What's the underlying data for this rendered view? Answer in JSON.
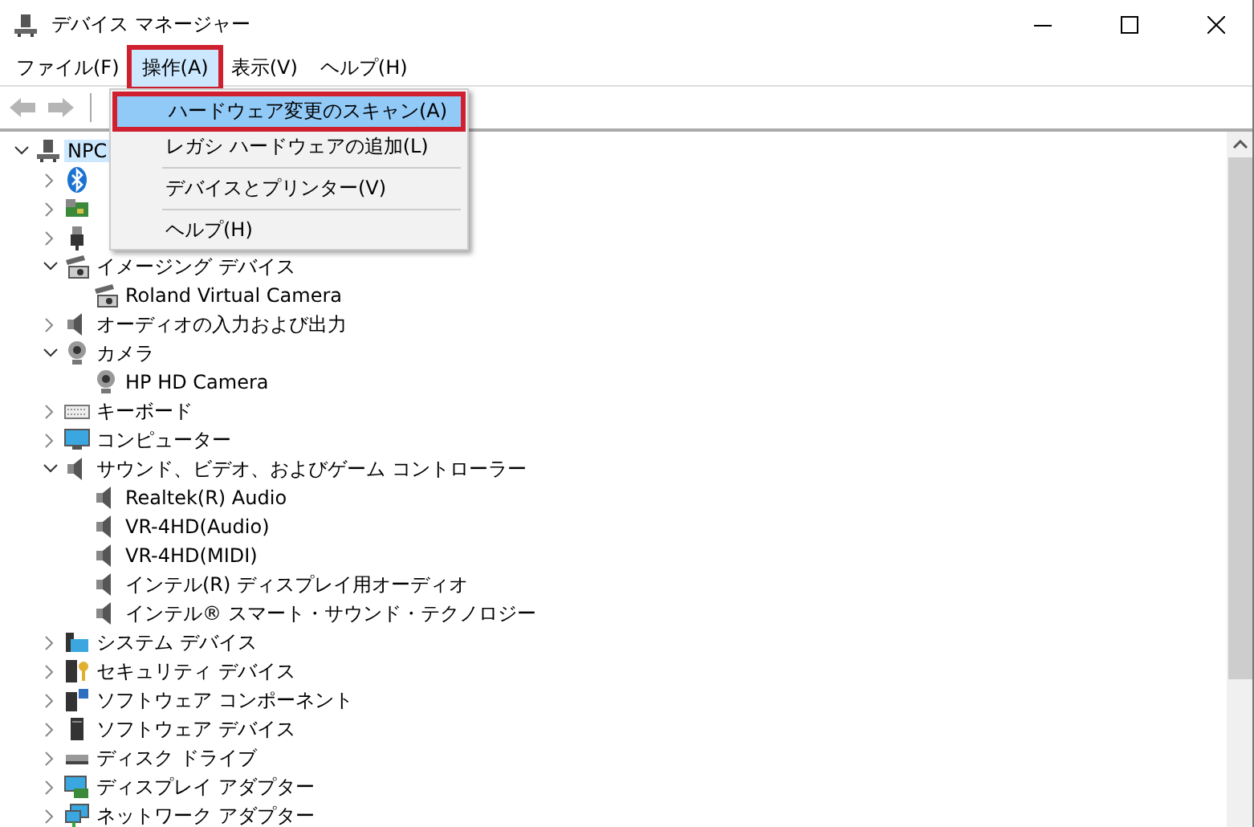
{
  "window": {
    "title": "デバイス マネージャー"
  },
  "menubar": [
    {
      "label": "ファイル(F)",
      "selected": false,
      "highlighted": false
    },
    {
      "label": "操作(A)",
      "selected": true,
      "highlighted": true
    },
    {
      "label": "表示(V)",
      "selected": false,
      "highlighted": false
    },
    {
      "label": "ヘルプ(H)",
      "selected": false,
      "highlighted": false
    }
  ],
  "toolbar": [
    {
      "kind": "back",
      "disabled": true
    },
    {
      "kind": "forward",
      "disabled": true
    }
  ],
  "menu": {
    "items": [
      {
        "kind": "item",
        "label": "ハードウェア変更のスキャン(A)",
        "selected": true,
        "highlighted": true
      },
      {
        "kind": "item",
        "label": "レガシ ハードウェアの追加(L)",
        "selected": false,
        "highlighted": false
      },
      {
        "kind": "separator"
      },
      {
        "kind": "item",
        "label": "デバイスとプリンター(V)",
        "selected": false,
        "highlighted": false
      },
      {
        "kind": "separator"
      },
      {
        "kind": "item",
        "label": "ヘルプ(H)",
        "selected": false,
        "highlighted": false
      }
    ]
  },
  "tree": [
    {
      "kind": "computer",
      "label": "NPC",
      "selected": true,
      "expanded": true,
      "children": [
        {
          "kind": "bluetooth",
          "expanded": false
        },
        {
          "kind": "card",
          "expanded": false
        },
        {
          "kind": "usb",
          "expanded": false
        },
        {
          "kind": "imaging",
          "label": "イメージング デバイス",
          "expanded": true,
          "children": [
            {
              "kind": "imaging",
              "label": "Roland Virtual Camera"
            }
          ]
        },
        {
          "kind": "speaker",
          "label": "オーディオの入力および出力",
          "expanded": false
        },
        {
          "kind": "webcam",
          "label": "カメラ",
          "expanded": true,
          "children": [
            {
              "kind": "webcam",
              "label": "HP HD Camera"
            }
          ]
        },
        {
          "kind": "keyboard",
          "label": "キーボード",
          "expanded": false
        },
        {
          "kind": "monitor",
          "label": "コンピューター",
          "expanded": false
        },
        {
          "kind": "speaker",
          "label": "サウンド、ビデオ、およびゲーム コントローラー",
          "expanded": true,
          "children": [
            {
              "kind": "speaker",
              "label": "Realtek(R) Audio"
            },
            {
              "kind": "speaker",
              "label": "VR-4HD(Audio)"
            },
            {
              "kind": "speaker",
              "label": "VR-4HD(MIDI)"
            },
            {
              "kind": "speaker",
              "label": "インテル(R) ディスプレイ用オーディオ"
            },
            {
              "kind": "speaker",
              "label": "インテル® スマート・サウンド・テクノロジー"
            }
          ]
        },
        {
          "kind": "system",
          "label": "システム デバイス",
          "expanded": false
        },
        {
          "kind": "security",
          "label": "セキュリティ デバイス",
          "expanded": false
        },
        {
          "kind": "component",
          "label": "ソフトウェア コンポーネント",
          "expanded": false
        },
        {
          "kind": "tower",
          "label": "ソフトウェア デバイス",
          "expanded": false
        },
        {
          "kind": "disk",
          "label": "ディスク ドライブ",
          "expanded": false
        },
        {
          "kind": "display",
          "label": "ディスプレイ アダプター",
          "expanded": false
        },
        {
          "kind": "network",
          "label": "ネットワーク アダプター",
          "expanded": false
        }
      ]
    }
  ]
}
